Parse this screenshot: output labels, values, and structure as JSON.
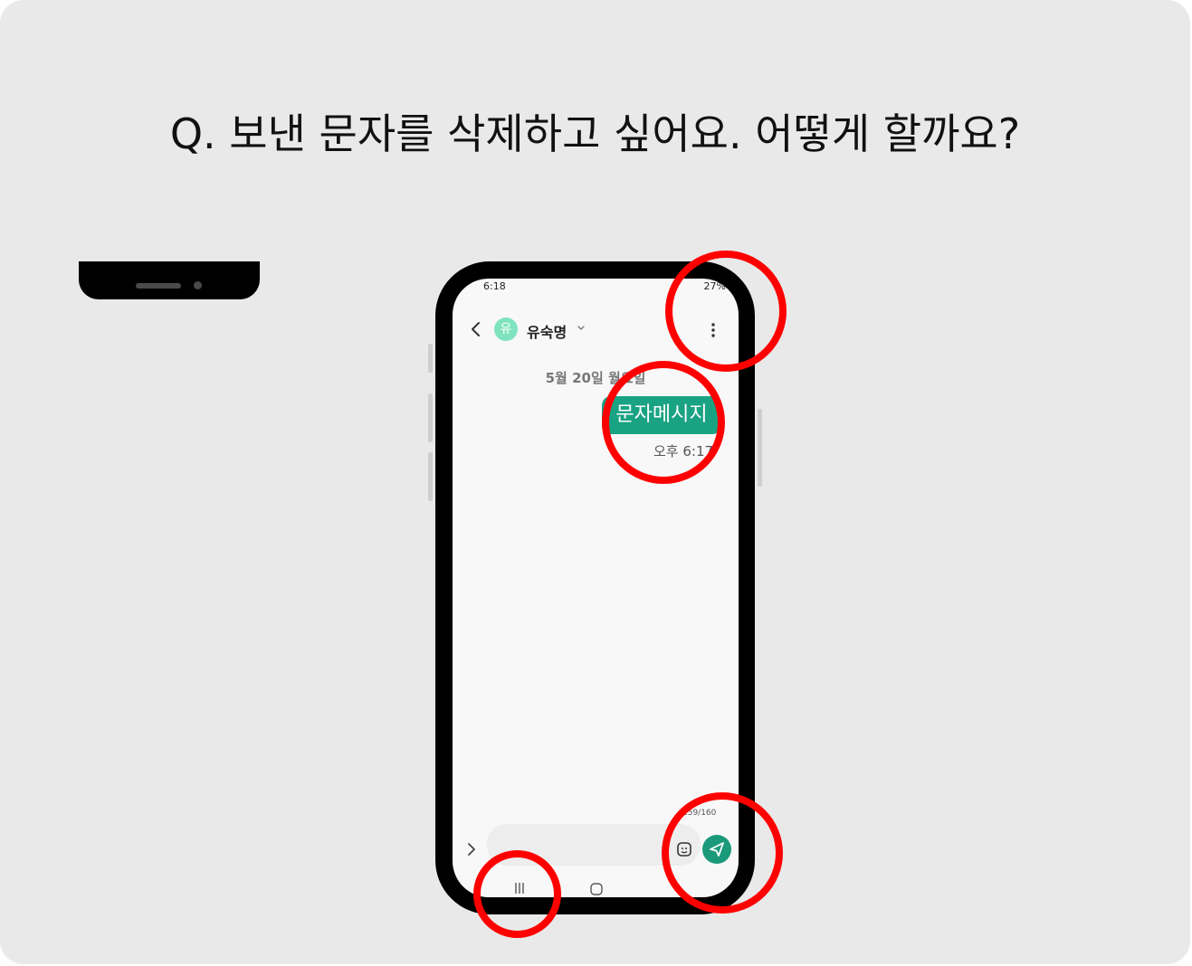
{
  "question": "Q. 보낸 문자를 삭제하고 싶어요. 어떻게 할까요?",
  "phone": {
    "status_bar": {
      "time": "6:18",
      "battery": "27%"
    },
    "header": {
      "avatar_letter": "유",
      "contact_name": "유숙명"
    },
    "conversation": {
      "date": "5월 20일 월요일",
      "message_text": "문자메시지",
      "message_time": "오후 6:17"
    },
    "composer": {
      "counter": "159/160",
      "placeholder": ""
    },
    "colors": {
      "accent": "#1aa383",
      "avatar": "#7fe3bf",
      "highlight": "#ff0000",
      "background": "#e9e9e9"
    },
    "icons": [
      "back-icon",
      "chevron-down-icon",
      "more-icon",
      "expand-icon",
      "sticker-icon",
      "send-icon",
      "nav-recent-icon",
      "nav-home-icon"
    ]
  }
}
